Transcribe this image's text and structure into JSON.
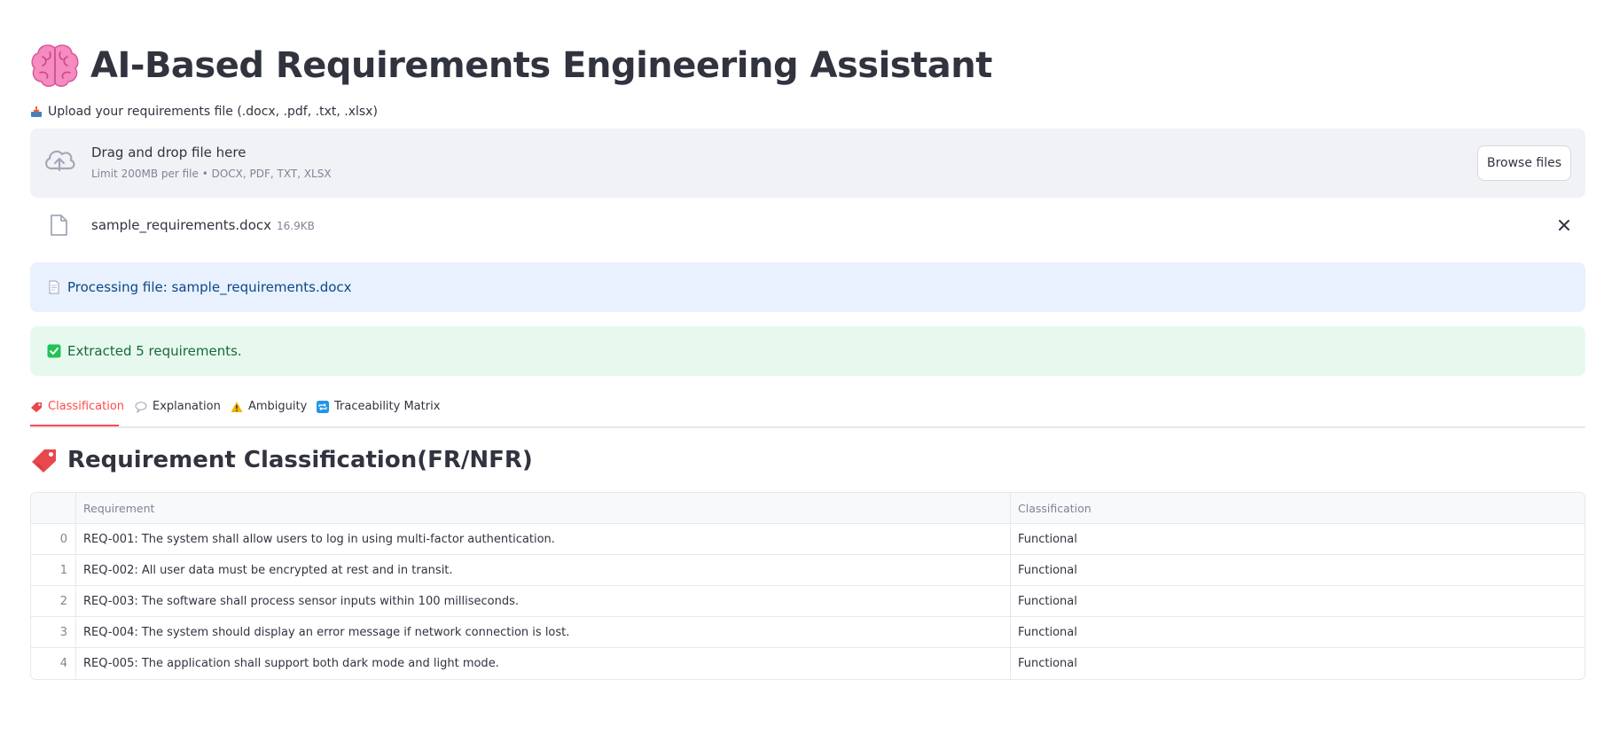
{
  "app": {
    "title": "AI-Based Requirements Engineering Assistant",
    "title_icon": "brain-emoji"
  },
  "uploader": {
    "label": "Upload your requirements file (.docx, .pdf, .txt, .xlsx)",
    "label_icon": "inbox-tray-icon",
    "drop_title": "Drag and drop file here",
    "drop_limit": "Limit 200MB per file • DOCX, PDF, TXT, XLSX",
    "browse_label": "Browse files"
  },
  "uploaded_file": {
    "name": "sample_requirements.docx",
    "size": "16.9KB"
  },
  "alerts": {
    "info": "Processing file: sample_requirements.docx",
    "success": "Extracted 5 requirements."
  },
  "tabs": [
    {
      "label": "Classification",
      "icon": "label-tag-icon",
      "active": true
    },
    {
      "label": "Explanation",
      "icon": "speech-balloon-icon",
      "active": false
    },
    {
      "label": "Ambiguity",
      "icon": "warning-icon",
      "active": false
    },
    {
      "label": "Traceability Matrix",
      "icon": "repeat-icon",
      "active": false
    }
  ],
  "section": {
    "title": "Requirement Classification(FR/NFR)",
    "icon": "label-tag-icon"
  },
  "table": {
    "columns": [
      "",
      "Requirement",
      "Classification"
    ],
    "rows": [
      {
        "index": "0",
        "requirement": "REQ-001: The system shall allow users to log in using multi-factor authentication.",
        "classification": "Functional"
      },
      {
        "index": "1",
        "requirement": "REQ-002: All user data must be encrypted at rest and in transit.",
        "classification": "Functional"
      },
      {
        "index": "2",
        "requirement": "REQ-003: The software shall process sensor inputs within 100 milliseconds.",
        "classification": "Functional"
      },
      {
        "index": "3",
        "requirement": "REQ-004: The system should display an error message if network connection is lost.",
        "classification": "Functional"
      },
      {
        "index": "4",
        "requirement": "REQ-005: The application shall support both dark mode and light mode.",
        "classification": "Functional"
      }
    ]
  },
  "colors": {
    "accent": "#ff4b4b",
    "info_bg": "#e8f1fd",
    "info_text": "#0b4788",
    "success_bg": "#e7f9ee",
    "success_text": "#17693a",
    "dropzone_bg": "#f0f2f6"
  }
}
